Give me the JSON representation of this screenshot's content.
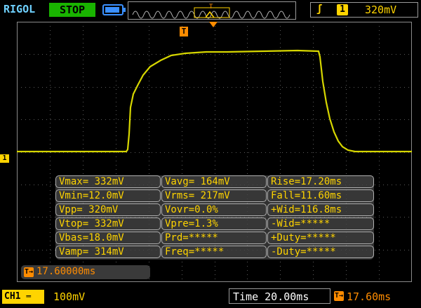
{
  "top_bar": {
    "brand": "RIGOL",
    "run_state": "STOP",
    "trigger_channel": "1",
    "trigger_level": "320mV"
  },
  "markers": {
    "channel": "1",
    "trigger_position": "T"
  },
  "measurements": [
    [
      "Vmax= 332mV",
      "Vavg= 164mV",
      "Rise=17.20ms"
    ],
    [
      "Vmin=12.0mV",
      "Vrms= 217mV",
      "Fall=11.60ms"
    ],
    [
      "Vpp= 320mV",
      "Vovr=0.0%",
      "+Wid=116.8ms"
    ],
    [
      "Vtop= 332mV",
      "Vpre=1.3%",
      "-Wid=*****"
    ],
    [
      "Vbas=18.0mV",
      "Prd=*****",
      "+Duty=*****"
    ],
    [
      "Vamp= 314mV",
      "Freq=*****",
      "-Duty=*****"
    ]
  ],
  "trigger_delay": "17.60000ms",
  "bottom_bar": {
    "channel_label": "CH1",
    "volts_per_div": "100mV",
    "time_per_div": "Time 20.00ms",
    "delay_short": "17.60ms"
  },
  "colors": {
    "trace": "#d6d600",
    "grid": "#5a5a5a",
    "brand": "#6fd1ff",
    "accent_yellow": "#ffd400",
    "accent_orange": "#ff8c00"
  }
}
